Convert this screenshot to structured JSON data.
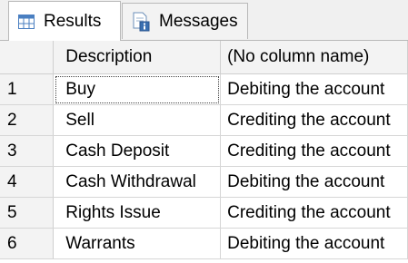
{
  "tabs": [
    {
      "label": "Results",
      "icon": "grid-icon",
      "active": true
    },
    {
      "label": "Messages",
      "icon": "messages-icon",
      "active": false
    }
  ],
  "grid": {
    "columns": [
      "Description",
      "(No column name)"
    ],
    "rows": [
      {
        "n": "1",
        "description": "Buy",
        "value": "Debiting the account"
      },
      {
        "n": "2",
        "description": "Sell",
        "value": "Crediting the account"
      },
      {
        "n": "3",
        "description": "Cash Deposit",
        "value": "Crediting the account"
      },
      {
        "n": "4",
        "description": "Cash Withdrawal",
        "value": "Debiting the account"
      },
      {
        "n": "5",
        "description": "Rights Issue",
        "value": "Crediting the account"
      },
      {
        "n": "6",
        "description": "Warrants",
        "value": "Debiting the account"
      }
    ]
  },
  "colors": {
    "header_bg": "#f3f3f3",
    "grid_line": "#d6d6d6",
    "grid_icon": "#4a7fc1"
  }
}
